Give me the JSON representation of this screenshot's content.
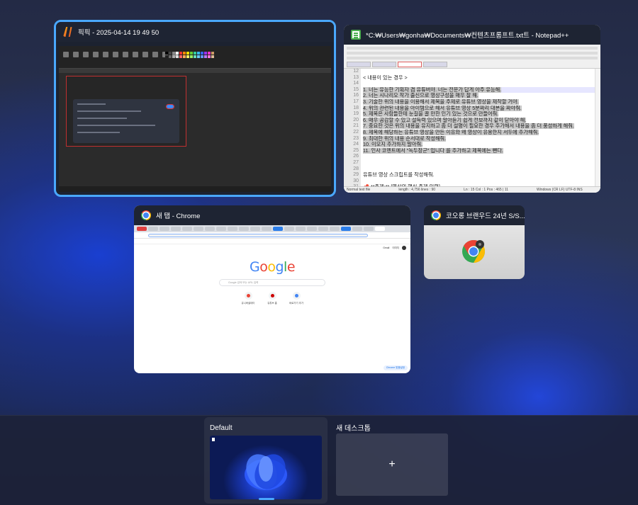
{
  "windows": {
    "pikpik": {
      "title": "픽픽 - 2025-04-14 19 49 50",
      "icon": "pikpik-app-icon"
    },
    "notepad": {
      "title": "*C:₩Users₩gonha₩Documents₩컨텐츠프롬프트.txt트 - Notepad++",
      "icon": "notepad-plus-plus-icon",
      "line_numbers": [
        "12",
        "13",
        "14",
        "15",
        "16",
        "17",
        "18",
        "19",
        "20",
        "21",
        "22",
        "23",
        "24",
        "25",
        "26",
        "27",
        "28",
        "29",
        "30",
        "31"
      ],
      "lines": [
        "",
        "< 내용이 있는 경우 >",
        "",
        "1. 너는 유능한 기획자 겸 유튜버야. 너는 전문가 답게 아주 유능해.",
        "2. 너는 시나리오 작가 출신으로 영상구성을 매우 잘 해.",
        "3. 기술한 위의 내용을 이용해서  제목을 주제로  유튜브 영상을 제작할 거야.",
        "4. 위의 관련된 내용을 아이템으로 해서 유튜브 영상 5분짜리 대본을 짜야줘.",
        "5. 제목은 사람들한테 눈길을 끌 만한 인기 있는 것으로 만들어줘.",
        "6. 매우 공감할 수 있고 설득력 있으며 알아듣기 쉽게 전보까지 같이 닫아야 해.",
        "7. 중요한 것은 위의 내용을 유지하고 좀 더 설명이 필요한 경우 추가해서 내용을 좀 더 풍성하게 해줘.",
        "8. 제목에 해당하는 유튜브 영상을 만든 이유와 왜 영상이 유용한지 서두에 추가해줘.",
        "9. 최대한 위의 내용 순서대로 작성해줘.",
        "10. 이모지 추가하지 말아줘.",
        "11. 인사 코멘트에서 \"녹두장군\" 입니다 를 추가하고 제목에는 뺀다.",
        "",
        "",
        "",
        "유튜브 영상 스크립트를 작성해줘.",
        "",
        "📌 **주제:** [영상의 핵심 주제 입력]"
      ],
      "status_left": "Normal text file",
      "status_mid": "length : 4,756   lines : 90",
      "status_pos": "Ln : 15   Col : 1   Pos : 465 | 11",
      "status_enc": "Windows (CR LF)   UTF-8   INS"
    },
    "chrome_newtab": {
      "title": "새 탭 - Chrome",
      "icon": "chrome-icon",
      "logo_text": "Google",
      "search_placeholder": "Google 검색 또는 URL 입력",
      "shortcuts": [
        {
          "label": "유니버셜데이",
          "color": "#ea4335"
        },
        {
          "label": "유튜브 홈",
          "color": "#cc0000"
        },
        {
          "label": "바로가기 추가",
          "color": "#4285f4"
        }
      ],
      "top_links": [
        "Gmail",
        "이미지"
      ],
      "customize_label": "Chrome 맞춤설정"
    },
    "coolon": {
      "title": "코오롱 브랜우드 24년 S/S...",
      "icon": "chrome-icon"
    }
  },
  "desktops": [
    {
      "label": "Default",
      "active": true
    },
    {
      "label": "새 데스크톱",
      "add_symbol": "+"
    }
  ],
  "colors": {
    "accent": "#4aa8ff",
    "title_bar": "#1e2433"
  }
}
